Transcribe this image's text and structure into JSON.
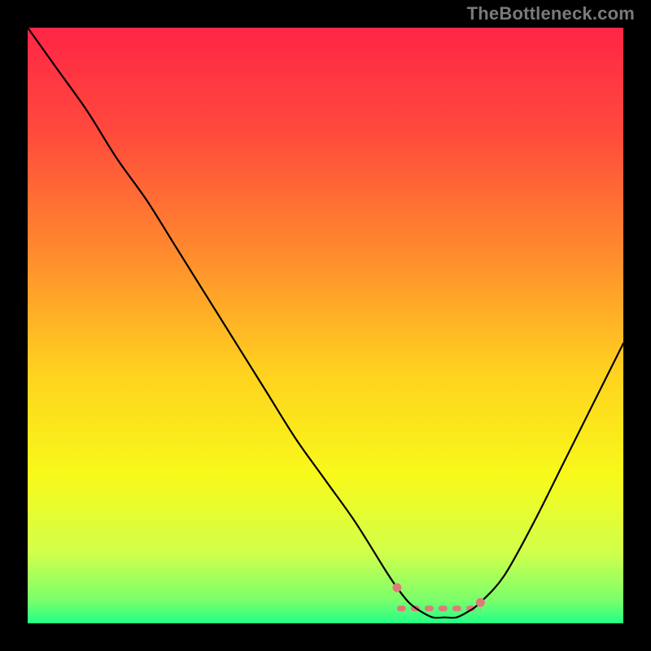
{
  "watermark": "TheBottleneck.com",
  "chart_data": {
    "type": "line",
    "title": "",
    "xlabel": "",
    "ylabel": "",
    "xlim": [
      0,
      100
    ],
    "ylim": [
      0,
      100
    ],
    "grid": false,
    "series": [
      {
        "name": "bottleneck-curve",
        "x": [
          0,
          5,
          10,
          15,
          20,
          25,
          30,
          35,
          40,
          45,
          50,
          55,
          60,
          62,
          64,
          66,
          68,
          70,
          72,
          74,
          76,
          80,
          85,
          90,
          95,
          100
        ],
        "values": [
          100,
          93,
          86,
          78,
          71,
          63,
          55,
          47,
          39,
          31,
          24,
          17,
          9,
          6,
          3.5,
          2,
          1,
          1,
          1,
          2,
          3.5,
          8,
          17,
          27,
          37,
          47
        ]
      }
    ],
    "highlight_band": {
      "x_start": 62,
      "x_end": 76,
      "y": 2.5
    },
    "highlight_dots": [
      {
        "x": 62,
        "y": 6
      },
      {
        "x": 76,
        "y": 3.5
      }
    ],
    "gradient_stops": [
      {
        "offset": 0.0,
        "color": "#ff2546"
      },
      {
        "offset": 0.18,
        "color": "#ff4b3c"
      },
      {
        "offset": 0.38,
        "color": "#ff8b2e"
      },
      {
        "offset": 0.58,
        "color": "#ffd21f"
      },
      {
        "offset": 0.75,
        "color": "#f8f91a"
      },
      {
        "offset": 0.88,
        "color": "#d2ff4a"
      },
      {
        "offset": 0.96,
        "color": "#7cff6b"
      },
      {
        "offset": 1.0,
        "color": "#22ff86"
      }
    ]
  }
}
